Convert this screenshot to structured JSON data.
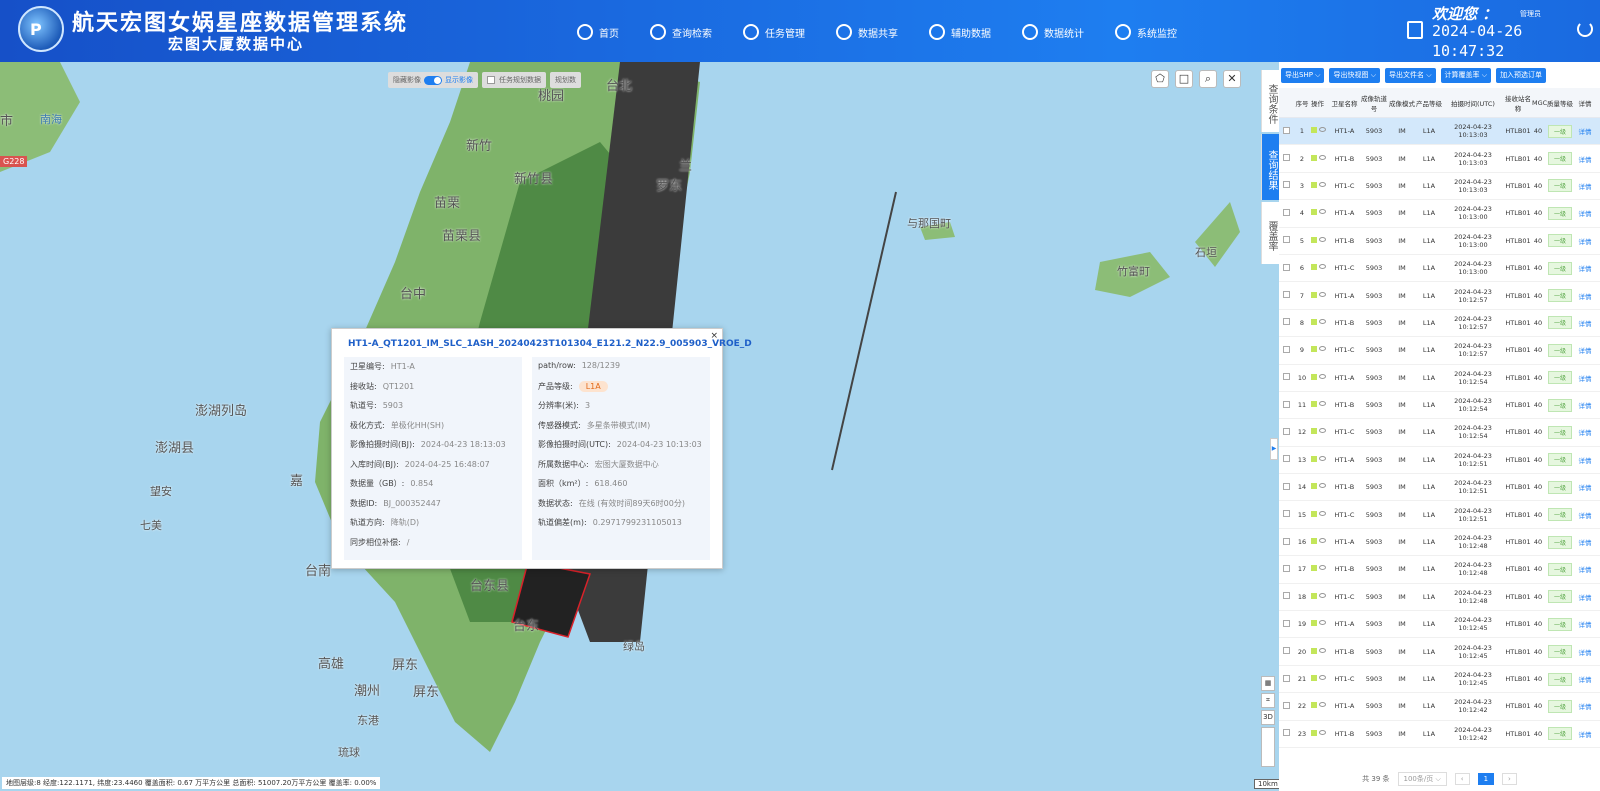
{
  "header": {
    "title": "航天宏图女娲星座数据管理系统",
    "subtitle": "宏图大厦数据中心",
    "logo_letter": "P",
    "nav": [
      {
        "label": "首页",
        "icon": "home-icon"
      },
      {
        "label": "查询检索",
        "icon": "search-icon"
      },
      {
        "label": "任务管理",
        "icon": "clipboard-icon"
      },
      {
        "label": "数据共享",
        "icon": "share-icon"
      },
      {
        "label": "辅助数据",
        "icon": "cloud-icon"
      },
      {
        "label": "数据统计",
        "icon": "chart-icon"
      },
      {
        "label": "系统监控",
        "icon": "eye-icon"
      }
    ],
    "welcome": "欢迎您 ：",
    "username": "管理员",
    "date": "2024-04-26",
    "time": "10:47:32"
  },
  "map": {
    "labels": [
      {
        "text": "台北",
        "cls": ""
      },
      {
        "text": "桃园",
        "cls": ""
      },
      {
        "text": "新竹",
        "cls": ""
      },
      {
        "text": "新竹县",
        "cls": ""
      },
      {
        "text": "苗栗",
        "cls": ""
      },
      {
        "text": "苗栗县",
        "cls": ""
      },
      {
        "text": "台中",
        "cls": ""
      },
      {
        "text": "澎湖列岛",
        "cls": ""
      },
      {
        "text": "澎湖县",
        "cls": ""
      },
      {
        "text": "望安",
        "cls": "sm"
      },
      {
        "text": "七美",
        "cls": "sm"
      },
      {
        "text": "嘉",
        "cls": ""
      },
      {
        "text": "台南",
        "cls": ""
      },
      {
        "text": "台东县",
        "cls": ""
      },
      {
        "text": "台东",
        "cls": ""
      },
      {
        "text": "高雄",
        "cls": ""
      },
      {
        "text": "屏东",
        "cls": ""
      },
      {
        "text": "潮州",
        "cls": ""
      },
      {
        "text": "屏东",
        "cls": ""
      },
      {
        "text": "东港",
        "cls": "sm"
      },
      {
        "text": "琉球",
        "cls": "sm"
      },
      {
        "text": "绿岛",
        "cls": "sm"
      },
      {
        "text": "与那国町",
        "cls": "sm"
      },
      {
        "text": "竹富町",
        "cls": "sm"
      },
      {
        "text": "石垣",
        "cls": "sm"
      },
      {
        "text": "市",
        "cls": ""
      },
      {
        "text": "南海",
        "cls": "sm blue"
      },
      {
        "text": "兰",
        "cls": ""
      },
      {
        "text": "罗东",
        "cls": ""
      }
    ],
    "road_badge": "G228",
    "toggles": {
      "hide_label": "隐藏影像",
      "show_label": "显示影像",
      "plan_label": "任务规划数据",
      "plan_btn": "规划数"
    },
    "tools": [
      "polygon-icon",
      "rectangle-icon",
      "search-icon",
      "close-icon"
    ],
    "side_tools": [
      "grid-icon",
      "ruler-icon",
      "3D",
      "zoom-bar"
    ],
    "scale": "10km",
    "status": "地图层级:8   经度:122.1171, 纬度:23.4460   覆盖面积: 0.67 万平方公里   总面积: 51007.20万平方公里   覆盖率: 0.00%"
  },
  "popup": {
    "title": "HT1-A_QT1201_IM_SLC_1ASH_20240423T101304_E121.2_N22.9_005903_VROE_D",
    "left": [
      {
        "k": "卫星编号:",
        "v": "HT1-A"
      },
      {
        "k": "接收站:",
        "v": "QT1201"
      },
      {
        "k": "轨道号:",
        "v": "5903"
      },
      {
        "k": "极化方式:",
        "v": "单极化HH(SH)"
      },
      {
        "k": "影像拍摄时间(BJ):",
        "v": "2024-04-23 18:13:03"
      },
      {
        "k": "入库时间(BJ):",
        "v": "2024-04-25 16:48:07"
      },
      {
        "k": "数据量（GB）:",
        "v": "0.854"
      },
      {
        "k": "数据ID:",
        "v": "BJ_000352447"
      },
      {
        "k": "轨道方向:",
        "v": "降轨(D)"
      },
      {
        "k": "同步相位补偿:",
        "v": "/"
      }
    ],
    "right": [
      {
        "k": "path/row:",
        "v": "128/1239"
      },
      {
        "k": "产品等级:",
        "v": "L1A",
        "badge": true
      },
      {
        "k": "分辨率(米):",
        "v": "3"
      },
      {
        "k": "传感器模式:",
        "v": "多星条带模式(IM)"
      },
      {
        "k": "影像拍摄时间(UTC):",
        "v": "2024-04-23 10:13:03"
      },
      {
        "k": "所属数据中心:",
        "v": "宏图大厦数据中心"
      },
      {
        "k": "面积（km²）:",
        "v": "618.460"
      },
      {
        "k": "数据状态:",
        "v": "在线 (有效时间89天6时00分)"
      },
      {
        "k": "轨道偏差(m):",
        "v": "0.2971799231105013"
      }
    ],
    "close": "×"
  },
  "tabs": [
    {
      "label": "查询条件",
      "active": false
    },
    {
      "label": "查询结果",
      "active": true
    },
    {
      "label": "覆盖率",
      "active": false
    }
  ],
  "panel": {
    "buttons": [
      "导出SHP ⌵",
      "导出快视图 ⌵",
      "导出文件名 ⌵",
      "计算覆盖率 ⌵",
      "加入预选订单"
    ],
    "columns": [
      "",
      "序号",
      "操作",
      "卫星名称",
      "成像轨道号",
      "成像模式",
      "产品等级",
      "拍摄时间(UTC)",
      "接收站名称",
      "MGC",
      "质量等级",
      "详情"
    ],
    "rows": [
      {
        "n": "1",
        "sat": "HT1-A",
        "orbit": "5903",
        "mode": "IM",
        "lvl": "L1A",
        "time": "2024-04-23 10:13:03",
        "st": "HTLB01",
        "mgc": "40",
        "q": "一级",
        "d": "详情"
      },
      {
        "n": "2",
        "sat": "HT1-B",
        "orbit": "5903",
        "mode": "IM",
        "lvl": "L1A",
        "time": "2024-04-23 10:13:03",
        "st": "HTLB01",
        "mgc": "40",
        "q": "一级",
        "d": "详情"
      },
      {
        "n": "3",
        "sat": "HT1-C",
        "orbit": "5903",
        "mode": "IM",
        "lvl": "L1A",
        "time": "2024-04-23 10:13:03",
        "st": "HTLB01",
        "mgc": "40",
        "q": "一级",
        "d": "详情"
      },
      {
        "n": "4",
        "sat": "HT1-A",
        "orbit": "5903",
        "mode": "IM",
        "lvl": "L1A",
        "time": "2024-04-23 10:13:00",
        "st": "HTLB01",
        "mgc": "40",
        "q": "一级",
        "d": "详情"
      },
      {
        "n": "5",
        "sat": "HT1-B",
        "orbit": "5903",
        "mode": "IM",
        "lvl": "L1A",
        "time": "2024-04-23 10:13:00",
        "st": "HTLB01",
        "mgc": "40",
        "q": "一级",
        "d": "详情"
      },
      {
        "n": "6",
        "sat": "HT1-C",
        "orbit": "5903",
        "mode": "IM",
        "lvl": "L1A",
        "time": "2024-04-23 10:13:00",
        "st": "HTLB01",
        "mgc": "40",
        "q": "一级",
        "d": "详情"
      },
      {
        "n": "7",
        "sat": "HT1-A",
        "orbit": "5903",
        "mode": "IM",
        "lvl": "L1A",
        "time": "2024-04-23 10:12:57",
        "st": "HTLB01",
        "mgc": "40",
        "q": "一级",
        "d": "详情"
      },
      {
        "n": "8",
        "sat": "HT1-B",
        "orbit": "5903",
        "mode": "IM",
        "lvl": "L1A",
        "time": "2024-04-23 10:12:57",
        "st": "HTLB01",
        "mgc": "40",
        "q": "一级",
        "d": "详情"
      },
      {
        "n": "9",
        "sat": "HT1-C",
        "orbit": "5903",
        "mode": "IM",
        "lvl": "L1A",
        "time": "2024-04-23 10:12:57",
        "st": "HTLB01",
        "mgc": "40",
        "q": "一级",
        "d": "详情"
      },
      {
        "n": "10",
        "sat": "HT1-A",
        "orbit": "5903",
        "mode": "IM",
        "lvl": "L1A",
        "time": "2024-04-23 10:12:54",
        "st": "HTLB01",
        "mgc": "40",
        "q": "一级",
        "d": "详情"
      },
      {
        "n": "11",
        "sat": "HT1-B",
        "orbit": "5903",
        "mode": "IM",
        "lvl": "L1A",
        "time": "2024-04-23 10:12:54",
        "st": "HTLB01",
        "mgc": "40",
        "q": "一级",
        "d": "详情"
      },
      {
        "n": "12",
        "sat": "HT1-C",
        "orbit": "5903",
        "mode": "IM",
        "lvl": "L1A",
        "time": "2024-04-23 10:12:54",
        "st": "HTLB01",
        "mgc": "40",
        "q": "一级",
        "d": "详情"
      },
      {
        "n": "13",
        "sat": "HT1-A",
        "orbit": "5903",
        "mode": "IM",
        "lvl": "L1A",
        "time": "2024-04-23 10:12:51",
        "st": "HTLB01",
        "mgc": "40",
        "q": "一级",
        "d": "详情"
      },
      {
        "n": "14",
        "sat": "HT1-B",
        "orbit": "5903",
        "mode": "IM",
        "lvl": "L1A",
        "time": "2024-04-23 10:12:51",
        "st": "HTLB01",
        "mgc": "40",
        "q": "一级",
        "d": "详情"
      },
      {
        "n": "15",
        "sat": "HT1-C",
        "orbit": "5903",
        "mode": "IM",
        "lvl": "L1A",
        "time": "2024-04-23 10:12:51",
        "st": "HTLB01",
        "mgc": "40",
        "q": "一级",
        "d": "详情"
      },
      {
        "n": "16",
        "sat": "HT1-A",
        "orbit": "5903",
        "mode": "IM",
        "lvl": "L1A",
        "time": "2024-04-23 10:12:48",
        "st": "HTLB01",
        "mgc": "40",
        "q": "一级",
        "d": "详情"
      },
      {
        "n": "17",
        "sat": "HT1-B",
        "orbit": "5903",
        "mode": "IM",
        "lvl": "L1A",
        "time": "2024-04-23 10:12:48",
        "st": "HTLB01",
        "mgc": "40",
        "q": "一级",
        "d": "详情"
      },
      {
        "n": "18",
        "sat": "HT1-C",
        "orbit": "5903",
        "mode": "IM",
        "lvl": "L1A",
        "time": "2024-04-23 10:12:48",
        "st": "HTLB01",
        "mgc": "40",
        "q": "一级",
        "d": "详情"
      },
      {
        "n": "19",
        "sat": "HT1-A",
        "orbit": "5903",
        "mode": "IM",
        "lvl": "L1A",
        "time": "2024-04-23 10:12:45",
        "st": "HTLB01",
        "mgc": "40",
        "q": "一级",
        "d": "详情"
      },
      {
        "n": "20",
        "sat": "HT1-B",
        "orbit": "5903",
        "mode": "IM",
        "lvl": "L1A",
        "time": "2024-04-23 10:12:45",
        "st": "HTLB01",
        "mgc": "40",
        "q": "一级",
        "d": "详情"
      },
      {
        "n": "21",
        "sat": "HT1-C",
        "orbit": "5903",
        "mode": "IM",
        "lvl": "L1A",
        "time": "2024-04-23 10:12:45",
        "st": "HTLB01",
        "mgc": "40",
        "q": "一级",
        "d": "详情"
      },
      {
        "n": "22",
        "sat": "HT1-A",
        "orbit": "5903",
        "mode": "IM",
        "lvl": "L1A",
        "time": "2024-04-23 10:12:42",
        "st": "HTLB01",
        "mgc": "40",
        "q": "一级",
        "d": "详情"
      },
      {
        "n": "23",
        "sat": "HT1-B",
        "orbit": "5903",
        "mode": "IM",
        "lvl": "L1A",
        "time": "2024-04-23 10:12:42",
        "st": "HTLB01",
        "mgc": "40",
        "q": "一级",
        "d": "详情"
      }
    ],
    "total": "共 39 条",
    "page_size": "100条/页 ⌵",
    "prev": "‹",
    "page": "1",
    "next": "›"
  }
}
